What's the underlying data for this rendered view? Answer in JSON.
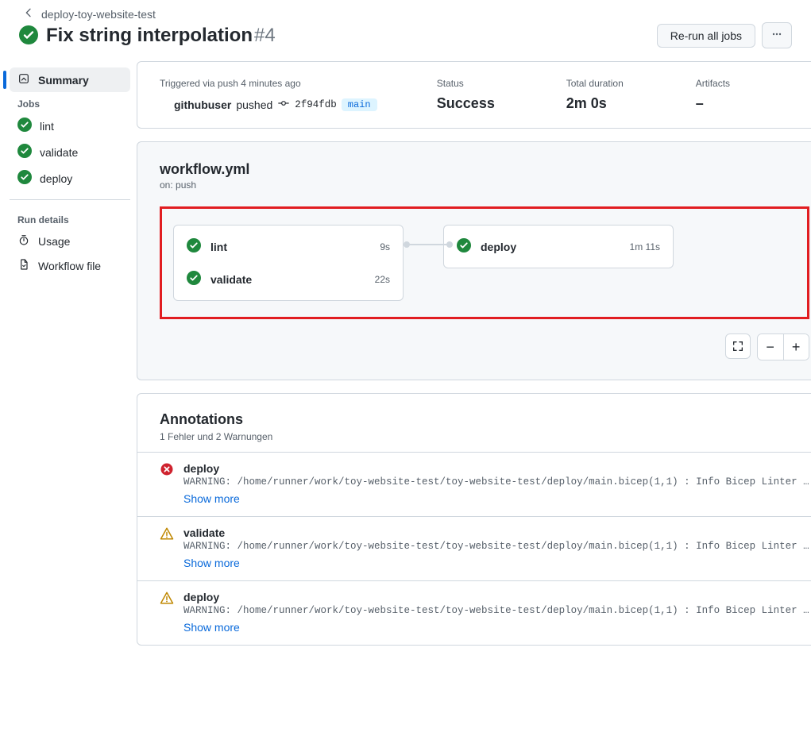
{
  "breadcrumb": "deploy-toy-website-test",
  "title": "Fix string interpolation",
  "run_number": "#4",
  "rerun_label": "Re-run all jobs",
  "sidebar": {
    "summary": "Summary",
    "jobs_heading": "Jobs",
    "jobs": [
      {
        "name": "lint"
      },
      {
        "name": "validate"
      },
      {
        "name": "deploy"
      }
    ],
    "run_details_heading": "Run details",
    "usage": "Usage",
    "workflow_file": "Workflow file"
  },
  "summary": {
    "trigger_label": "Triggered via push 4 minutes ago",
    "user": "githubuser",
    "pushed_word": "pushed",
    "sha": "2f94fdb",
    "branch": "main",
    "status_label": "Status",
    "status_value": "Success",
    "duration_label": "Total duration",
    "duration_value": "2m 0s",
    "artifacts_label": "Artifacts",
    "artifacts_value": "–"
  },
  "workflow": {
    "file": "workflow.yml",
    "on": "on: push",
    "stage1": [
      {
        "name": "lint",
        "time": "9s"
      },
      {
        "name": "validate",
        "time": "22s"
      }
    ],
    "stage2": [
      {
        "name": "deploy",
        "time": "1m 11s"
      }
    ]
  },
  "annotations": {
    "title": "Annotations",
    "subtitle": "1 Fehler und 2 Warnungen",
    "show_more": "Show more",
    "items": [
      {
        "type": "error",
        "job": "deploy",
        "msg": "WARNING: /home/runner/work/toy-website-test/toy-website-test/deploy/main.bicep(1,1) : Info Bicep Linter …"
      },
      {
        "type": "warning",
        "job": "validate",
        "msg": "WARNING: /home/runner/work/toy-website-test/toy-website-test/deploy/main.bicep(1,1) : Info Bicep Linter …"
      },
      {
        "type": "warning",
        "job": "deploy",
        "msg": "WARNING: /home/runner/work/toy-website-test/toy-website-test/deploy/main.bicep(1,1) : Info Bicep Linter …"
      }
    ]
  }
}
